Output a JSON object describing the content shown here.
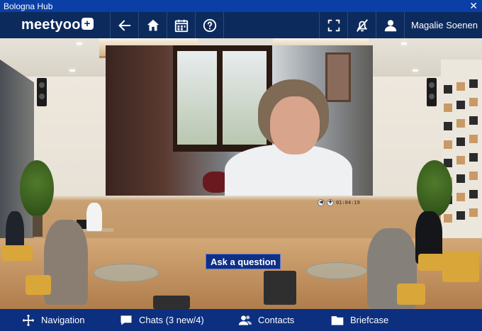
{
  "window": {
    "title": "Bologna Hub",
    "close_glyph": "✕"
  },
  "topnav": {
    "logo_text": "meetyoo",
    "logo_plus": "+",
    "buttons": [
      {
        "name": "back-arrow-icon"
      },
      {
        "name": "home-icon"
      },
      {
        "name": "calendar-icon"
      },
      {
        "name": "help-icon"
      },
      {
        "name": "fullscreen-icon"
      },
      {
        "name": "notifications-off-icon"
      },
      {
        "name": "user-icon"
      }
    ],
    "username": "Magalie Soenen"
  },
  "video": {
    "time": "01:04:19",
    "controls": [
      {
        "name": "volume-icon",
        "glyph": "◀"
      },
      {
        "name": "settings-icon",
        "glyph": "✚"
      }
    ]
  },
  "ask_button": {
    "label": "Ask a question"
  },
  "bottombar": {
    "items": [
      {
        "label": "Navigation",
        "icon": "move-icon"
      },
      {
        "label": "Chats (3 new/4)",
        "icon": "chat-icon"
      },
      {
        "label": "Contacts",
        "icon": "contacts-icon"
      },
      {
        "label": "Briefcase",
        "icon": "folder-icon"
      }
    ]
  },
  "colors": {
    "title_bar": "#0a3fa6",
    "top_nav": "#0c2a5c",
    "bottom_bar": "#0c2f7f",
    "ask_button": "#0e2f86"
  }
}
